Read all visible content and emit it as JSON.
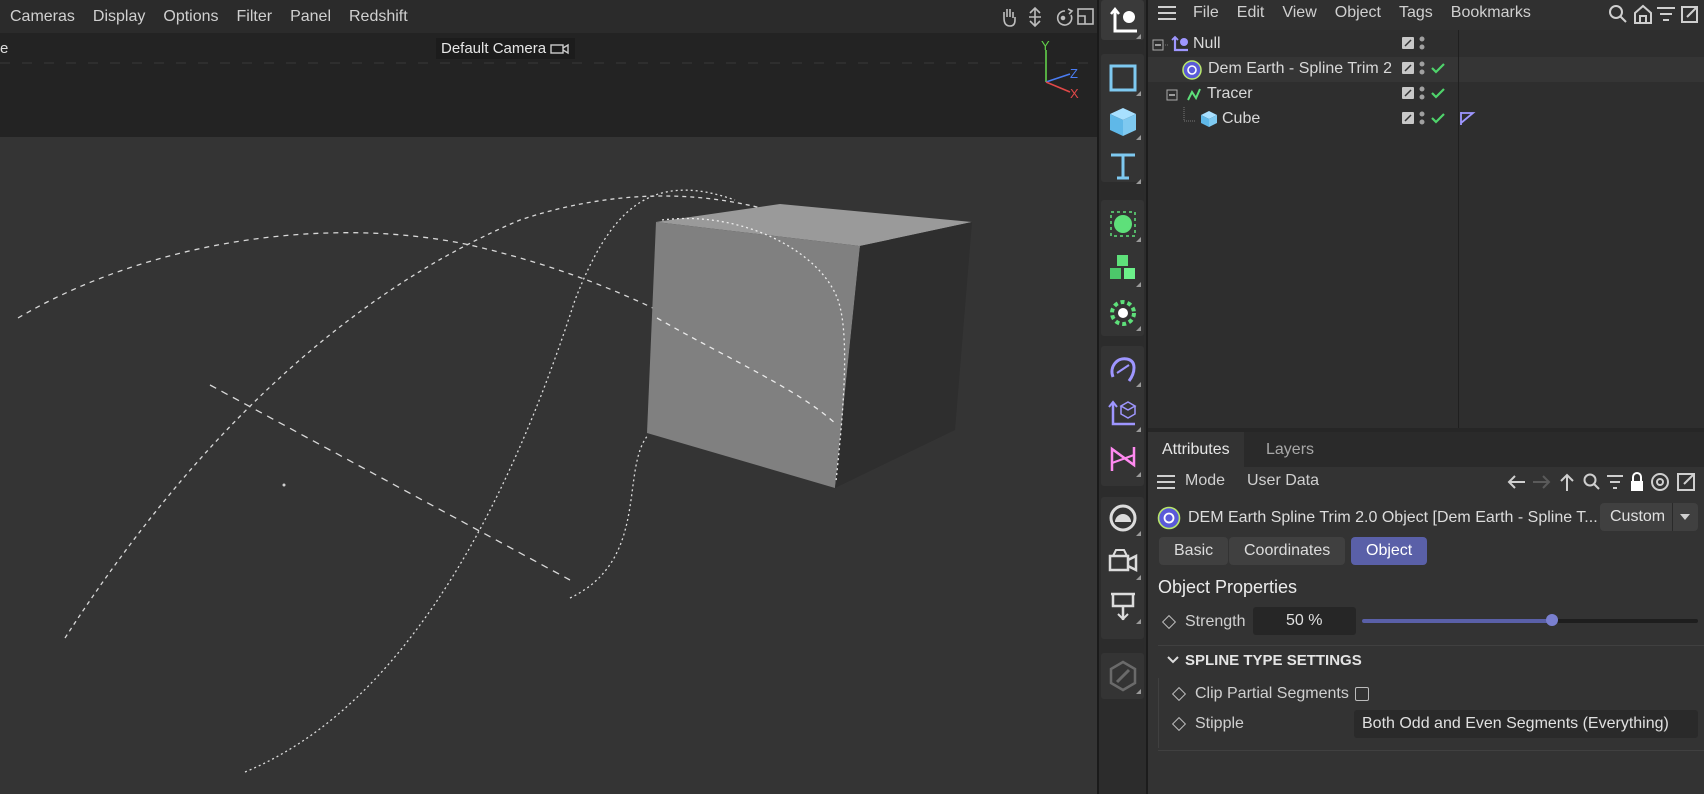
{
  "viewport": {
    "menu": [
      "Cameras",
      "Display",
      "Options",
      "Filter",
      "Panel",
      "Redshift"
    ],
    "edge_label": "e",
    "camera_label": "Default Camera",
    "axis": {
      "y": "Y",
      "z": "Z",
      "x": "X"
    }
  },
  "object_manager": {
    "menu": [
      "File",
      "Edit",
      "View",
      "Object",
      "Tags",
      "Bookmarks"
    ],
    "objects": [
      {
        "name": "Null"
      },
      {
        "name": "Dem Earth - Spline Trim 2"
      },
      {
        "name": "Tracer"
      },
      {
        "name": "Cube"
      }
    ]
  },
  "attributes": {
    "tabs": [
      "Attributes",
      "Layers"
    ],
    "mode_menu": [
      "Mode",
      "User Data"
    ],
    "object_title": "DEM Earth Spline Trim 2.0 Object [Dem Earth - Spline T...",
    "preset": "Custom",
    "page_tabs": [
      "Basic",
      "Coordinates",
      "Object"
    ],
    "active_page": "Object",
    "section_title": "Object Properties",
    "strength_label": "Strength",
    "strength_value": "50 %",
    "strength_fraction": 0.5,
    "group_title": "SPLINE TYPE SETTINGS",
    "clip_label": "Clip Partial Segments",
    "clip_checked": false,
    "stipple_label": "Stipple",
    "stipple_value": "Both Odd and Even Segments (Everything)"
  },
  "colors": {
    "accent": "#5a60a8",
    "check_green": "#4fd36b",
    "icon_green": "#5ee07a",
    "icon_blue": "#7ec9f0",
    "icon_purple": "#9e96ff"
  }
}
